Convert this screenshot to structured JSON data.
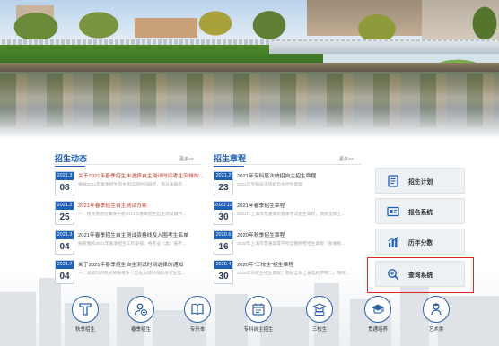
{
  "news": {
    "title": "招生动态",
    "more": "更多>>",
    "items": [
      {
        "ym": "2021.3",
        "day": "08",
        "title": "关于2021年春季招生未选择自主测试时间考生安排的...",
        "summary": "根据2021年春季招生自主测试的时间规定，现对未报名...",
        "red": true
      },
      {
        "ym": "2021.2",
        "day": "25",
        "title": "2021年春季招生自主测试方案",
        "summary": "一、指导思想为确保学校2021年春季招生自主测试顺利...",
        "red": true
      },
      {
        "ym": "2021.3",
        "day": "04",
        "title": "2021年春季招生自主测试资格线及入围考生名单",
        "summary": "按照我校2021年春季招生工作安排，各专业（类）按不...",
        "red": false
      },
      {
        "ym": "2021.7",
        "day": "04",
        "title": "关于2021年春季招生自主测试时间选择的通知",
        "summary": "一、测试时间我校将安排多个自主测试时间段供考生选...",
        "red": false
      }
    ]
  },
  "rules": {
    "title": "招生章程",
    "more": "更多>>",
    "items": [
      {
        "ym": "2021.2",
        "day": "23",
        "title": "2021年专科层次统招自主招生章程",
        "summary": "2021年专科层次统招自主招生章程"
      },
      {
        "ym": "2020.12",
        "day": "30",
        "title": "2021年春季招生章程",
        "summary": "2021年上海市普通高校春季考试招生章程，我校全称上..."
      },
      {
        "ym": "2020.6",
        "day": "16",
        "title": "2020年秋季招生章程",
        "summary": "2020年上海市普通高等学校全国统考招生章程（秋季统..."
      },
      {
        "ym": "2020.4",
        "day": "30",
        "title": "2020年“三校生”招生章程",
        "summary": "2020年三校生招生章程，我校全称上海电机学院二，院校..."
      }
    ]
  },
  "side_buttons": [
    {
      "label": "招生计划",
      "icon": "document-list-icon"
    },
    {
      "label": "报名系统",
      "icon": "id-card-icon"
    },
    {
      "label": "历年分数",
      "icon": "bar-chart-icon"
    },
    {
      "label": "查询系统",
      "icon": "magnifier-plus-icon"
    }
  ],
  "bottom_nav": [
    {
      "label": "秋季招生",
      "icon": "t-letter-icon"
    },
    {
      "label": "春季招生",
      "icon": "person-plus-icon"
    },
    {
      "label": "专升本",
      "icon": "book-icon"
    },
    {
      "label": "专科自主招生",
      "icon": "calendar-icon"
    },
    {
      "label": "三校生",
      "icon": "graduation-diploma-icon"
    },
    {
      "label": "贯通培养",
      "icon": "graduation-cap-icon"
    },
    {
      "label": "艺术类",
      "icon": "artist-icon"
    }
  ],
  "colors": {
    "primary": "#1f5fb4",
    "accent_red": "#c0392b",
    "highlight_box": "#e0271c"
  }
}
